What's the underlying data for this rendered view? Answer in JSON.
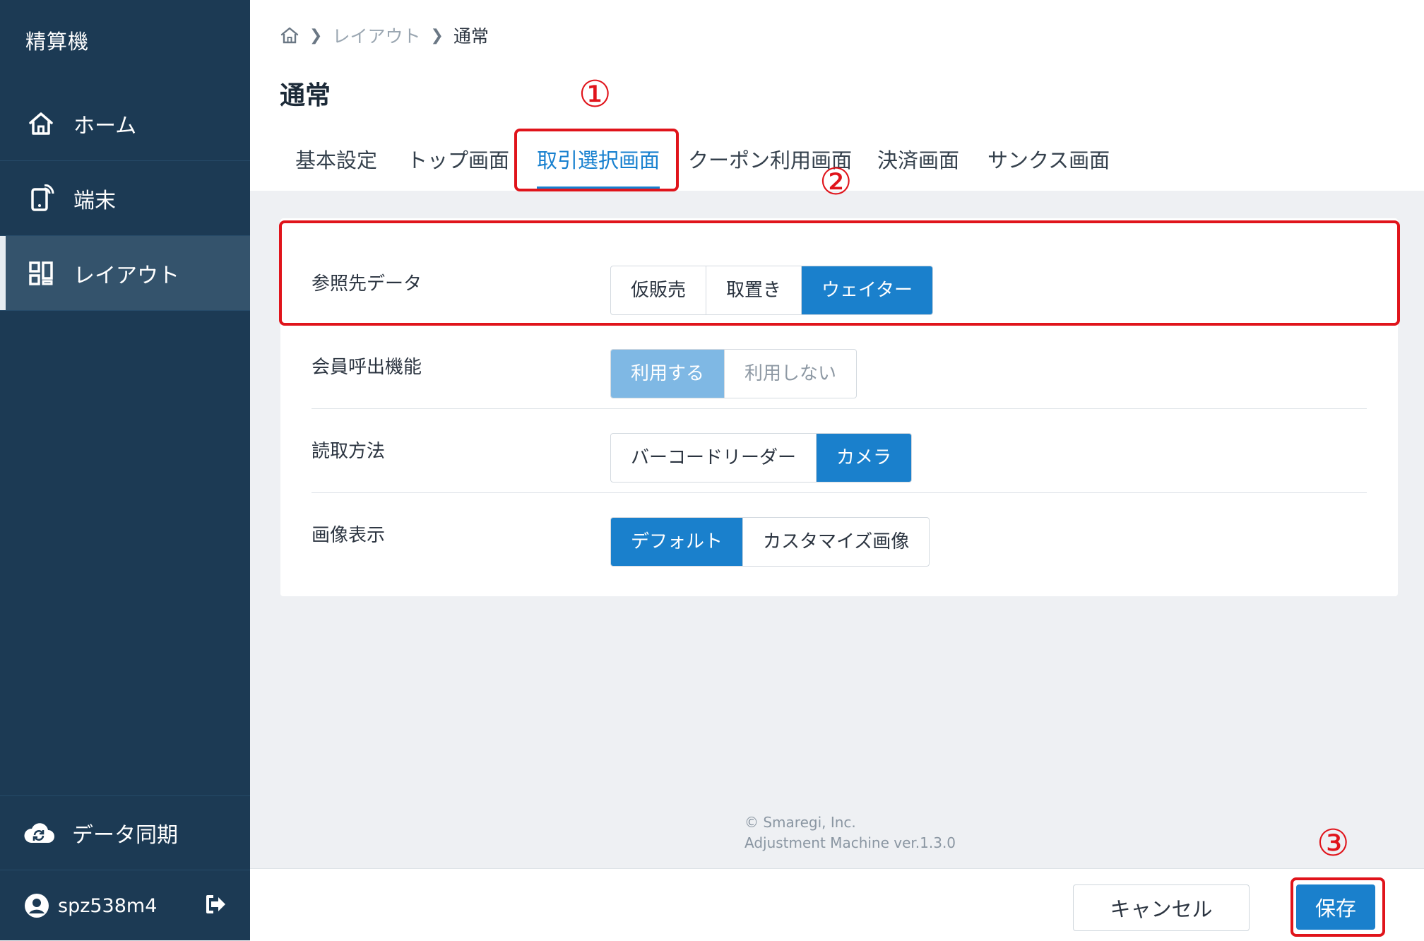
{
  "sidebar": {
    "app_title": "精算機",
    "items": [
      {
        "label": "ホーム",
        "icon": "home-icon"
      },
      {
        "label": "端末",
        "icon": "tablet-icon"
      },
      {
        "label": "レイアウト",
        "icon": "layout-icon",
        "active": true
      }
    ],
    "sync_label": "データ同期",
    "username": "spz538m4"
  },
  "breadcrumb": {
    "items": [
      "レイアウト",
      "通常"
    ]
  },
  "page_title": "通常",
  "tabs": [
    {
      "label": "基本設定"
    },
    {
      "label": "トップ画面"
    },
    {
      "label": "取引選択画面",
      "active": true
    },
    {
      "label": "クーポン利用画面"
    },
    {
      "label": "決済画面"
    },
    {
      "label": "サンクス画面"
    }
  ],
  "settings": [
    {
      "label": "参照先データ",
      "options": [
        "仮販売",
        "取置き",
        "ウェイター"
      ],
      "selected": "ウェイター"
    },
    {
      "label": "会員呼出機能",
      "options": [
        "利用する",
        "利用しない"
      ],
      "selected": "利用する",
      "disabled": true
    },
    {
      "label": "読取方法",
      "options": [
        "バーコードリーダー",
        "カメラ"
      ],
      "selected": "カメラ"
    },
    {
      "label": "画像表示",
      "options": [
        "デフォルト",
        "カスタマイズ画像"
      ],
      "selected": "デフォルト"
    }
  ],
  "copyright": {
    "line1": "© Smaregi, Inc.",
    "line2": "Adjustment Machine ver.1.3.0"
  },
  "footer": {
    "cancel_label": "キャンセル",
    "save_label": "保存"
  },
  "annotations": [
    "①",
    "②",
    "③"
  ],
  "colors": {
    "sidebar_bg": "#1c3a54",
    "accent": "#1a80cc",
    "annotation": "#e0141b"
  }
}
